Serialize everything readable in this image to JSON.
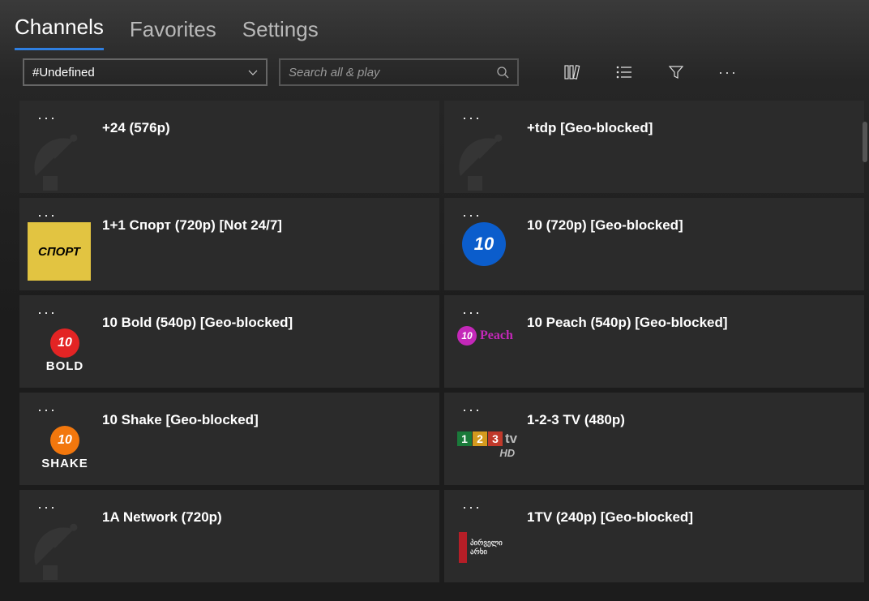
{
  "tabs": {
    "channels": "Channels",
    "favorites": "Favorites",
    "settings": "Settings"
  },
  "filter": {
    "selected": "#Undefined"
  },
  "search": {
    "placeholder": "Search all & play"
  },
  "channels": [
    {
      "title": "+24 (576p)",
      "logo": "dish"
    },
    {
      "title": "+tdp [Geo-blocked]",
      "logo": "dish"
    },
    {
      "title": "1+1 Спорт (720p) [Not 24/7]",
      "logo": "sport",
      "logo_text": "СПОРТ"
    },
    {
      "title": "10 (720p) [Geo-blocked]",
      "logo": "ten",
      "logo_text": "10"
    },
    {
      "title": "10 Bold (540p) [Geo-blocked]",
      "logo": "bold",
      "logo_text_top": "10",
      "logo_text_bottom": "BOLD"
    },
    {
      "title": "10 Peach (540p) [Geo-blocked]",
      "logo": "peach",
      "logo_text_top": "10",
      "logo_text_bottom": "Peach"
    },
    {
      "title": "10 Shake [Geo-blocked]",
      "logo": "shake",
      "logo_text_top": "10",
      "logo_text_bottom": "SHAKE"
    },
    {
      "title": "1-2-3 TV (480p)",
      "logo": "123",
      "logo_1": "1",
      "logo_2": "2",
      "logo_3": "3",
      "logo_tv": "tv",
      "logo_hd": "HD"
    },
    {
      "title": "1A Network (720p)",
      "logo": "dish"
    },
    {
      "title": "1TV (240p) [Geo-blocked]",
      "logo": "1tv",
      "logo_text": "პირველი\nარხი"
    }
  ]
}
